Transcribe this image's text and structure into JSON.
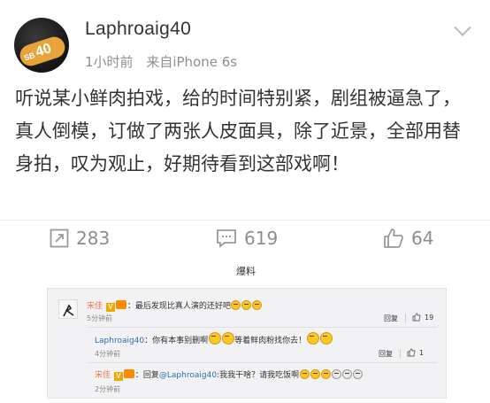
{
  "post": {
    "username": "Laphroaig40",
    "avatar_text": "SB",
    "avatar_number": "40",
    "time": "1小时前",
    "source": "来自iPhone 6s",
    "content": "听说某小鲜肉拍戏，给的时间特别紧，剧组被逼急了，真人倒模，订做了两张人皮面具，除了近景，全部用替身拍，叹为观止，好期待看到这部戏啊！",
    "repost_count": "283",
    "comment_count": "619",
    "like_count": "64"
  },
  "caption": "爆料",
  "comments": [
    {
      "name": "宋佳",
      "text": "：最后发现比真人演的还好吧",
      "time": "5分钟前",
      "reply_label": "回复",
      "likes": "19"
    },
    {
      "name": "Laphroaig40",
      "text_a": "：你有本事别删啊",
      "text_b": "等着鲜肉粉找你去！",
      "time": "4分钟前",
      "reply_label": "回复",
      "likes": "1"
    },
    {
      "name": "宋佳",
      "text_a": "：回复",
      "mention": "@Laphroaig40",
      "text_b": ":我我干啥？请我吃饭啊",
      "time": "2分钟前"
    }
  ],
  "colors": {
    "name": "#eb7350",
    "link": "#2a6fb8",
    "muted": "#8d8d8d",
    "panel": "#f2f2f5"
  },
  "icons": [
    "chevron-down-icon",
    "repost-icon",
    "comment-icon",
    "like-icon",
    "vip-icon",
    "verified-icon",
    "emoji-icon",
    "thumb-icon"
  ]
}
